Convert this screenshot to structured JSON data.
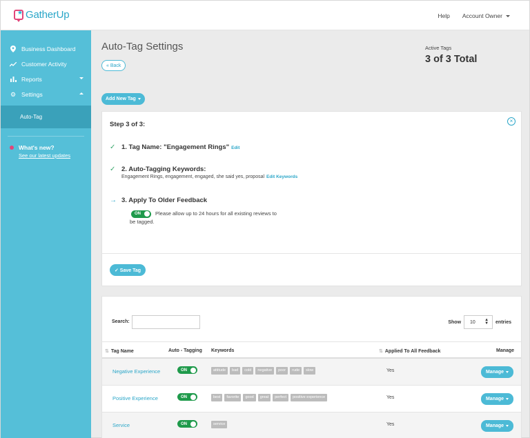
{
  "app": {
    "logo_text": "GatherUp"
  },
  "header": {
    "help_label": "Help",
    "account_label": "Account Owner"
  },
  "sidebar": {
    "items": [
      {
        "label": "Business Dashboard",
        "icon": "map-pin-icon"
      },
      {
        "label": "Customer Activity",
        "icon": "trend-line-icon"
      },
      {
        "label": "Reports",
        "icon": "bar-chart-icon"
      },
      {
        "label": "Settings",
        "icon": "gear-icon"
      }
    ],
    "active_sub_item": "Auto-Tag",
    "whats_new": {
      "title": "What's new?",
      "link": "See our latest updates"
    }
  },
  "page": {
    "title": "Auto-Tag Settings",
    "back_label": "« Back",
    "active_tags_label": "Active Tags",
    "active_tags_value": "3 of 3 Total",
    "add_tag_label": "Add New Tag"
  },
  "step_card": {
    "step_title": "Step 3 of 3:",
    "step1": {
      "label": "1. Tag Name: \"Engagement Rings\"",
      "edit": "Edit"
    },
    "step2": {
      "label": "2. Auto-Tagging Keywords:",
      "keywords": "Engagement Rings, engagement, engaged, she said yes, proposal",
      "edit": "Edit Keywords"
    },
    "step3": {
      "label": "3. Apply To Older Feedback",
      "toggle": "ON",
      "desc_line1": "Please allow up to 24 hours for all existing reviews to",
      "desc_line2": "be tagged."
    },
    "save_label": "✓ Save Tag"
  },
  "table": {
    "search_label": "Search:",
    "show_label": "Show",
    "show_value": "10",
    "entries_label": "entries",
    "headers": {
      "tag_name": "Tag Name",
      "auto_tagging": "Auto - Tagging",
      "keywords": "Keywords",
      "applied": "Applied To All Feedback",
      "manage": "Manage"
    },
    "rows": [
      {
        "name": "Negative Experience",
        "toggle": "ON",
        "keywords": [
          "attitude",
          "bad",
          "cold",
          "negative",
          "poor",
          "rude",
          "slow"
        ],
        "applied": "Yes",
        "manage": "Manage"
      },
      {
        "name": "Positive Experience",
        "toggle": "ON",
        "keywords": [
          "best",
          "favorite",
          "good",
          "great",
          "perfect",
          "positive experience"
        ],
        "applied": "Yes",
        "manage": "Manage"
      },
      {
        "name": "Service",
        "toggle": "ON",
        "keywords": [
          "service"
        ],
        "applied": "Yes",
        "manage": "Manage"
      }
    ]
  },
  "colors": {
    "accent": "#4cbad6",
    "sidebar": "#55bfd8",
    "toggle_on": "#1f9a4b",
    "brand_pink": "#e2457a"
  }
}
